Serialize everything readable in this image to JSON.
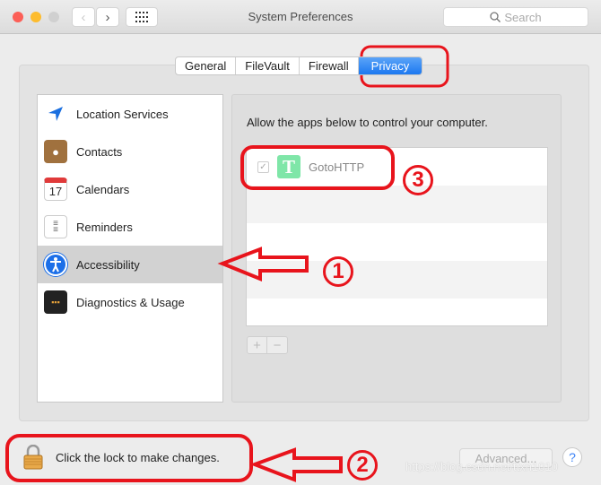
{
  "window": {
    "title": "System Preferences",
    "search_placeholder": "Search"
  },
  "tabs": [
    {
      "label": "General"
    },
    {
      "label": "FileVault"
    },
    {
      "label": "Firewall"
    },
    {
      "label": "Privacy",
      "active": true
    }
  ],
  "sidebar": {
    "items": [
      {
        "label": "Location Services",
        "icon": "location-arrow-icon"
      },
      {
        "label": "Contacts",
        "icon": "contacts-book-icon"
      },
      {
        "label": "Calendars",
        "icon": "calendar-icon",
        "icon_text": "17"
      },
      {
        "label": "Reminders",
        "icon": "reminders-list-icon"
      },
      {
        "label": "Accessibility",
        "icon": "accessibility-person-icon",
        "selected": true
      },
      {
        "label": "Diagnostics & Usage",
        "icon": "diagnostics-grid-icon"
      }
    ]
  },
  "main": {
    "instruction": "Allow the apps below to control your computer.",
    "apps": [
      {
        "name": "GotoHTTP",
        "checked": true,
        "icon_letter": "T"
      }
    ],
    "add_label": "+",
    "remove_label": "−"
  },
  "footer": {
    "lock_text": "Click the lock to make changes.",
    "advanced_label": "Advanced...",
    "help_label": "?"
  },
  "annotations": {
    "n1": "1",
    "n2": "2",
    "n3": "3",
    "color": "#e8141c"
  },
  "watermark": "https://blog.csdn.net/ttxn1010"
}
